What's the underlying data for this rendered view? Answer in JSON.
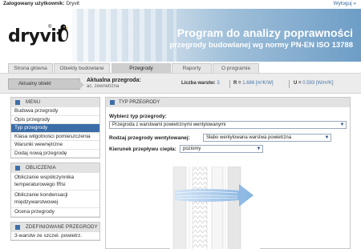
{
  "topbar": {
    "user_label": "Zalogowany użytkownik:",
    "user_name": "Dryvit",
    "logout": "Wyloguj »"
  },
  "logo": {
    "text": "dryvit",
    "reg": "®"
  },
  "banner": {
    "title": "Program do analizy poprawności",
    "subtitle": "przegrody budowlanej wg normy PN-EN ISO 13788"
  },
  "tabs": [
    {
      "label": "Strona główna"
    },
    {
      "label": "Obiekty budowlane"
    },
    {
      "label": "Przegrody"
    },
    {
      "label": "Raporty"
    },
    {
      "label": "O programie"
    }
  ],
  "status": {
    "current_object_button": "Aktualny obiekt",
    "current_partition_label": "Aktualna przegroda:",
    "current_partition_value": "ac. zewnetrzna",
    "layers_label": "Liczba warstw:",
    "layers_value": "3",
    "r_label": "R =",
    "r_value": "1.686 [m²K/W]",
    "u_label": "U =",
    "u_value": "0.593 [W/m²K]"
  },
  "sidebar": {
    "menu": {
      "title": "MENU",
      "items": [
        "Budowa przegrody",
        "Opis przegrody",
        "Typ przegrody",
        "Klasa wilgotności pomieszczenia",
        "Warunki wewnętrzne",
        "Dodaj nową przegrodę"
      ]
    },
    "calc": {
      "title": "OBLICZENIA",
      "items": [
        "Obliczanie współczynnika temperaturowego fRsi",
        "Obliczanie kondensacji międzywarstwowej",
        "Ocena przegrody"
      ]
    },
    "saved": {
      "title": "ZDEFINIOWANE PRZEGRODY",
      "items": [
        "3-warstw ze szczel. powietrz."
      ]
    }
  },
  "main": {
    "title": "TYP PRZEGRODY",
    "type_label": "Wybierz typ przegrody:",
    "type_value": "Przegroda z warstwami powietrznymi wentylowanymi",
    "vent_label": "Rodzaj przegrody wentylowanej:",
    "vent_value": "Słabo wentylowana warstwa powietrzna",
    "flow_label": "Kierunek przepływu ciepła:",
    "flow_value": "poziomy"
  },
  "colors": {
    "accent": "#3b6ea8",
    "banner_end": "#6d9dc6",
    "arrow": "#6fa6dd"
  }
}
